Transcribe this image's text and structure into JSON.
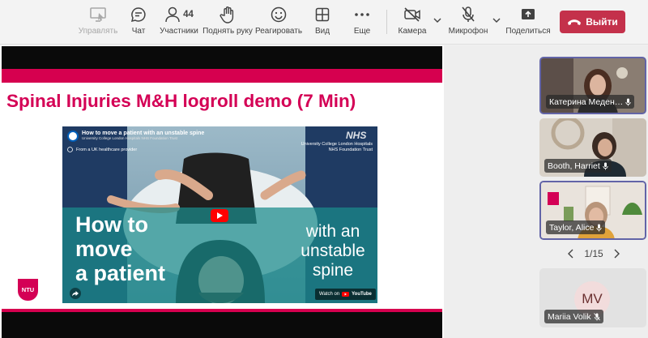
{
  "toolbar": {
    "control": "Управлять",
    "chat": "Чат",
    "participants": "Участники",
    "participants_count": "44",
    "raise_hand": "Поднять руку",
    "react": "Реагировать",
    "view": "Вид",
    "more": "Еще",
    "camera": "Камера",
    "mic": "Микрофон",
    "share": "Поделиться",
    "leave": "Выйти"
  },
  "slide": {
    "title": "Spinal Injuries M&H logroll demo (7 Min)",
    "logo": "NTU"
  },
  "video": {
    "title": "How to move a patient with an unstable spine",
    "channel": "University College London Hospitals NHS Foundation Trust",
    "provider": "From a UK healthcare provider",
    "nhs": "NHS",
    "trust_line1": "University College London Hospitals",
    "trust_line2": "NHS Foundation Trust",
    "big_left": [
      "How to",
      "move",
      "a patient"
    ],
    "big_right": [
      "with an",
      "unstable",
      "spine"
    ],
    "watch_on": "Watch on",
    "youtube": "YouTube"
  },
  "participants": [
    {
      "name": "Катерина Меден…"
    },
    {
      "name": "Booth, Harriet"
    },
    {
      "name": "Taylor, Alice"
    },
    {
      "name": "Mariia Volik",
      "initials": "MV"
    }
  ],
  "pager": {
    "text": "1/15"
  },
  "colors": {
    "accent": "#6264a7",
    "leave": "#c4314b",
    "slide_pink": "#d40055",
    "teal": "#1b8c8c"
  }
}
